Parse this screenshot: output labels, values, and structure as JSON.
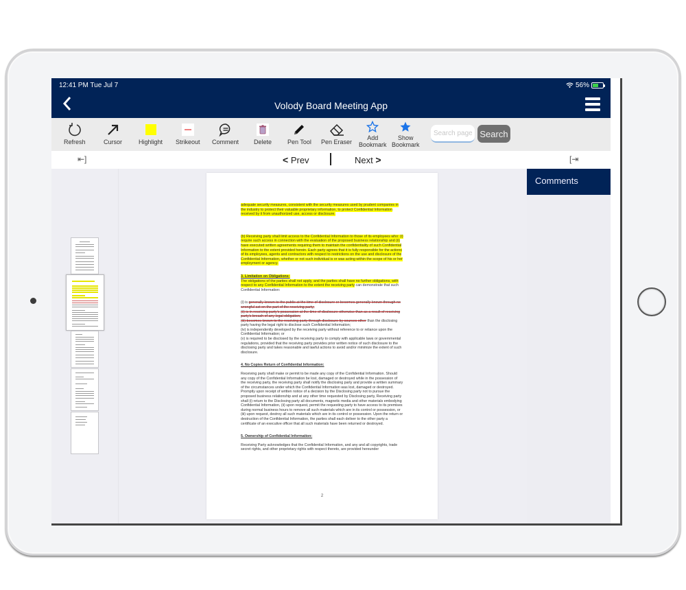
{
  "status_bar": {
    "time": "12:41 PM  Tue Jul 7",
    "wifi_icon": "wifi-icon",
    "battery_percent": "56%",
    "battery_level": 0.56,
    "battery_charging": true
  },
  "header": {
    "back_icon": "chevron-left-icon",
    "title": "Volody Board Meeting App",
    "menu_icon": "hamburger-menu-icon"
  },
  "toolbar": {
    "tools": [
      {
        "id": "refresh",
        "label": "Refresh",
        "icon": "refresh-icon"
      },
      {
        "id": "cursor",
        "label": "Cursor",
        "icon": "arrow-cursor-icon"
      },
      {
        "id": "highlight",
        "label": "Highlight",
        "icon": "highlight-swatch-icon",
        "color": "#ffff00"
      },
      {
        "id": "strikeout",
        "label": "Strikeout",
        "icon": "strikeout-swatch-icon",
        "color": "#f08080"
      },
      {
        "id": "comment",
        "label": "Comment",
        "icon": "speech-bubble-icon"
      },
      {
        "id": "delete",
        "label": "Delete",
        "icon": "trash-icon"
      },
      {
        "id": "pen",
        "label": "Pen Tool",
        "icon": "pencil-icon"
      },
      {
        "id": "eraser",
        "label": "Pen Eraser",
        "icon": "eraser-icon"
      },
      {
        "id": "add_bookmark",
        "label_line1": "Add",
        "label_line2": "Bookmark",
        "icon": "star-outline-icon",
        "color": "#1a73e8"
      },
      {
        "id": "show_bookmark",
        "label_line1": "Show",
        "label_line2": "Bookmark",
        "icon": "star-filled-icon",
        "color": "#1a73e8"
      }
    ],
    "search_placeholder": "Search page",
    "search_value": "",
    "search_button": "Search"
  },
  "navbar": {
    "collapse_left": "⇤]",
    "prev_label": "Prev",
    "next_label": "Next",
    "expand_right": "[⇥"
  },
  "thumbnails": {
    "count": 5,
    "selected_index": 1
  },
  "document": {
    "page_number": "2",
    "p1": "adequate security measures, consistent with the security measures used by prudent companies in the industry to protect their valuable proprietary information, to protect Confidential Information received by it from unauthorized use, access or disclosure.",
    "p2": "(b) Receiving party shall limit access to the Confidential Information to those of its employees who: (i) require such access in connection with the evaluation of the proposed business relationship and (ii) have executed written agreements requiring them to maintain the confidentiality of such Confidential Information to the extent provided herein. Each party agrees that it is fully responsible for the actions of its employees, agents and contractors with respect to restrictions on the use and disclosure of the Confidential Information, whether or not such individual is or was acting within the scope of his or her employment or agency.",
    "h3": "3. Limitation on Obligations:",
    "p3_hl": "The obligations of the parties shall not apply, and the parties shall have no further obligations, with respect to any Confidential Information to the extent the receiving party",
    "p3_rest": " can demonstrate that such Confidential Information:",
    "item_i_prefix": "(i)  is ",
    "item_i_strike": "generally known to the public at the time of disclosure or becomes generally known through no wrongful act on the part of the receiving party;",
    "item_ii_strike": "(ii)  is in receiving party's possession at the time of disclosure otherwise than as a result of receiving party's breach of any legal obligation;",
    "item_iii_strike": "(iii)  becomes known to the receiving party through disclosure by sources other",
    "item_iii_rest": " than the disclosing party having the legal right to disclose such Confidential Information;",
    "item_iv": "(iv)  is independently developed by the receiving party without reference to or reliance upon the Confidential Information; or",
    "item_v": "(v)  is required to be disclosed by the receiving party to comply with applicable laws or governmental regulations, provided that the receiving party provides prior written notice of such disclosure to the disclosing party and takes reasonable and lawful actions to avoid and/or minimize the extent of such disclosure.",
    "h4": "4. No Copies Return of Confidential Information:",
    "p4": "Receiving party shall make or permit to be made any copy of the Confidential Information. Should any copy of the Confidential Information be lost, damaged or destroyed while in the possession of the receiving party, the receiving party shall notify the disclosing party and provide a written summary of the circumstances under which the Confidential Information was lost, damaged or destroyed. Promptly upon receipt of written notice of a decision by the Disclosing party not to pursue the proposed business relationship and at any other time requested by Disclosing party, Receiving party shall (i) return to the Disclosing party all documents, magnetic media and other materials embodying Confidential Information, (ii) upon request, permit the requesting party to have access to its premises during normal business hours to remove all such materials which are in its control or possession, or (iii) upon request, destroy all such materials which are in its control or possession.  Upon the return or destruction of the Confidential Information, the parties shall each deliver to the other party a certificate of an executive officer that all such materials have been returned or destroyed.",
    "h5": "5. Ownership of Confidential Information:",
    "p5": "Receiving Party acknowledges that the Confidential Information, and any and all copyrights, trade secret rights, and other proprietary rights with respect thereto, are provided hereunder"
  },
  "comments": {
    "title": "Comments",
    "items": []
  },
  "colors": {
    "brand_navy": "#012357",
    "highlight": "#ffff00",
    "strikeout": "#d03030",
    "bookmark_blue": "#1a73e8",
    "search_button": "#707070"
  }
}
